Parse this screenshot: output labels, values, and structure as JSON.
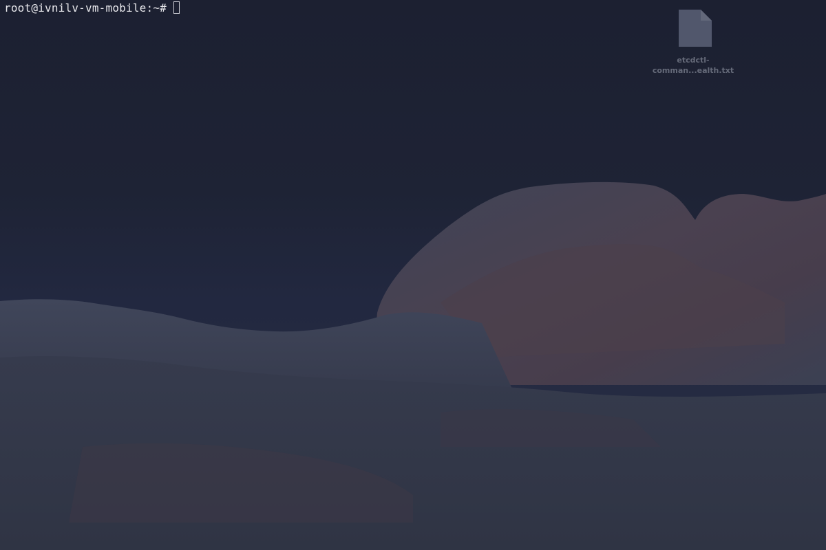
{
  "desktop": {
    "file": {
      "name_line1": "etcdctl-",
      "name_line2": "comman...ealth.txt",
      "icon": "text-file-icon"
    }
  },
  "terminal": {
    "prompt": "root@ivnilv-vm-mobile:~#"
  },
  "colors": {
    "background": "#1c2031",
    "terminal_text": "#e8e8ec"
  }
}
